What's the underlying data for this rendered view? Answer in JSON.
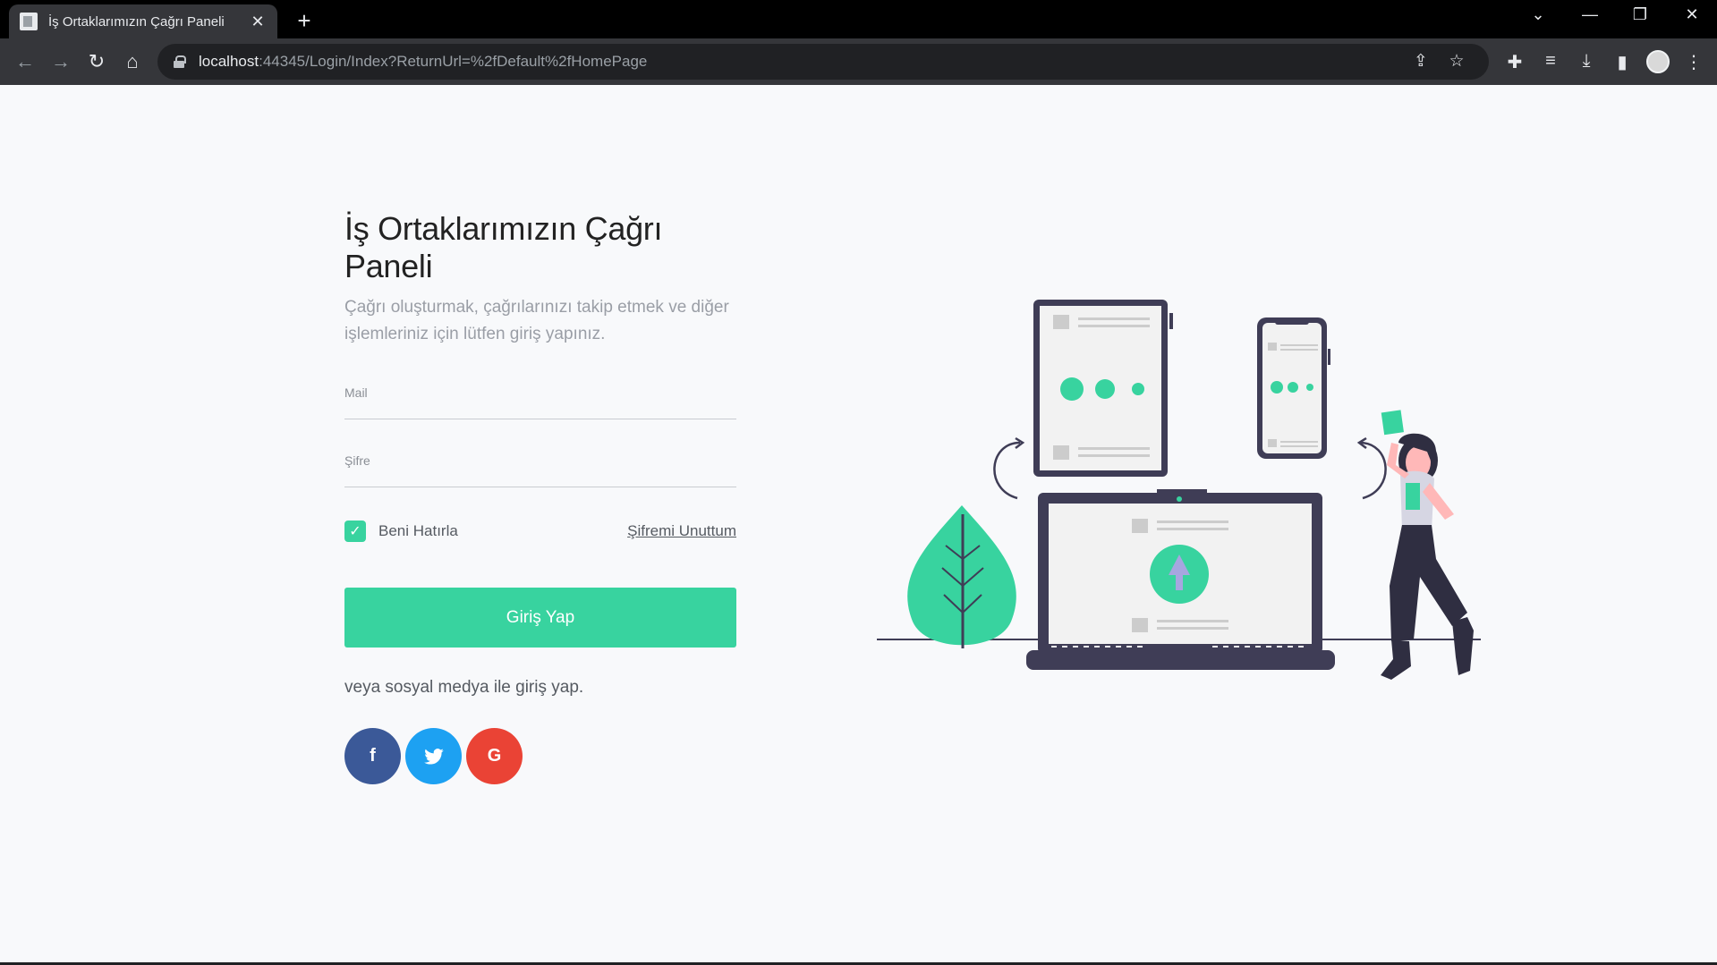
{
  "browser": {
    "tab_title": "İş Ortaklarımızın Çağrı Paneli",
    "tab_close": "✕",
    "new_tab": "+",
    "url_host": "localhost",
    "url_rest": ":44345/Login/Index?ReturnUrl=%2fDefault%2fHomePage",
    "window_controls": {
      "tabs_menu": "⌄",
      "minimize": "—",
      "restore": "❐",
      "close": "✕"
    },
    "nav": {
      "back": "←",
      "forward": "→",
      "reload": "↻",
      "home": "⌂"
    }
  },
  "login": {
    "title": "İş Ortaklarımızın Çağrı Paneli",
    "subtitle": "Çağrı oluşturmak, çağrılarınızı takip etmek ve diğer işlemleriniz için lütfen giriş yapınız.",
    "mail_label": "Mail",
    "password_label": "Şifre",
    "remember_label": "Beni Hatırla",
    "remember_checked": true,
    "forgot_label": "Şifremi Unuttum",
    "submit_label": "Giriş Yap",
    "social_text": "veya sosyal medya ile giriş yap.",
    "socials": {
      "facebook": "f",
      "twitter": "🐦",
      "google": "G"
    }
  },
  "colors": {
    "accent": "#38d39f",
    "facebook": "#3b5998",
    "twitter": "#1da1f2",
    "google": "#ea4335",
    "dark": "#3f3d56"
  }
}
